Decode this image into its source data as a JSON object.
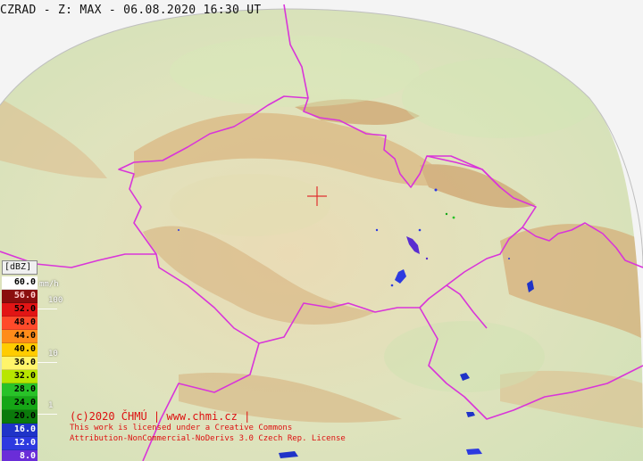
{
  "title": "CZRAD - Z: MAX - 06.08.2020 16:30 UT",
  "legend": {
    "unit": "[dBZ]",
    "rows": [
      {
        "label": "60.0",
        "color": "#ffffff",
        "text": "#000000"
      },
      {
        "label": "56.0",
        "color": "#8a0e0e",
        "text": "#ffcccc"
      },
      {
        "label": "52.0",
        "color": "#e21515",
        "text": "#000000"
      },
      {
        "label": "48.0",
        "color": "#ff4a2a",
        "text": "#000000"
      },
      {
        "label": "44.0",
        "color": "#ff8c1a",
        "text": "#000000"
      },
      {
        "label": "40.0",
        "color": "#ffcc00",
        "text": "#000000"
      },
      {
        "label": "36.0",
        "color": "#fff46a",
        "text": "#000000"
      },
      {
        "label": "32.0",
        "color": "#b8e600",
        "text": "#000000"
      },
      {
        "label": "28.0",
        "color": "#28c228",
        "text": "#000000"
      },
      {
        "label": "24.0",
        "color": "#16a616",
        "text": "#000000"
      },
      {
        "label": "20.0",
        "color": "#0b7a0b",
        "text": "#000000"
      },
      {
        "label": "16.0",
        "color": "#1f33c8",
        "text": "#ffffff"
      },
      {
        "label": "12.0",
        "color": "#2d3ae0",
        "text": "#ffffff"
      },
      {
        "label": "8.0",
        "color": "#6a2dd8",
        "text": "#ffffff"
      }
    ]
  },
  "rain_scale": {
    "unit": "mm/h",
    "labels": [
      {
        "text": "100"
      },
      {
        "text": "10"
      },
      {
        "text": "1"
      }
    ]
  },
  "copyright": {
    "line1": "(c)2020 ČHMÚ | www.chmi.cz |",
    "line2": "This work is licensed under a Creative Commons",
    "line3": "Attribution-NonCommercial-NoDerivs 3.0 Czech Rep. License"
  },
  "colors": {
    "border": "#d935d9",
    "marker": "#e03030",
    "outside": "#f4f4f4"
  }
}
